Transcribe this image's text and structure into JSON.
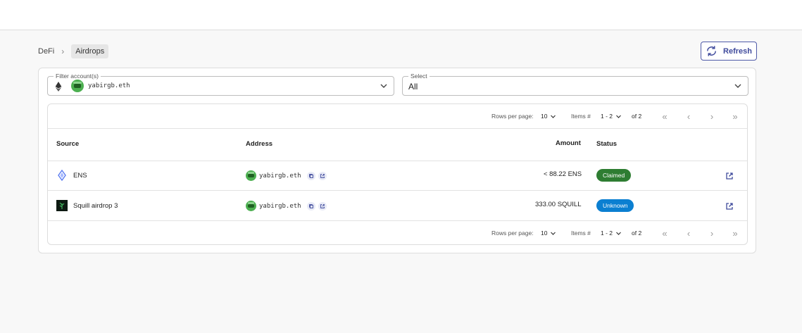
{
  "breadcrumb": {
    "parent": "DeFi",
    "separator": "›",
    "current": "Airdrops"
  },
  "toolbar": {
    "refresh_label": "Refresh"
  },
  "filter": {
    "account_label": "Filter account(s)",
    "account_value": "yabirgb.eth",
    "select_label": "Select",
    "select_value": "All"
  },
  "pagination": {
    "rows_per_page_label": "Rows per page:",
    "rows_per_page_value": "10",
    "items_label": "Items #",
    "items_range": "1 - 2",
    "of_label": "of 2"
  },
  "table": {
    "columns": {
      "source": "Source",
      "address": "Address",
      "amount": "Amount",
      "status": "Status"
    },
    "rows": [
      {
        "source": "ENS",
        "address": "yabirgb.eth",
        "amount": "< 88.22 ENS",
        "status": "Claimed",
        "status_color": "#2e7d32"
      },
      {
        "source": "Squill airdrop 3",
        "address": "yabirgb.eth",
        "amount": "333.00 SQUILL",
        "status": "Unknown",
        "status_color": "#0b7fd1"
      }
    ]
  },
  "colors": {
    "accent": "#3f4a9c",
    "claimed": "#2e7d32",
    "unknown": "#0b7fd1"
  }
}
